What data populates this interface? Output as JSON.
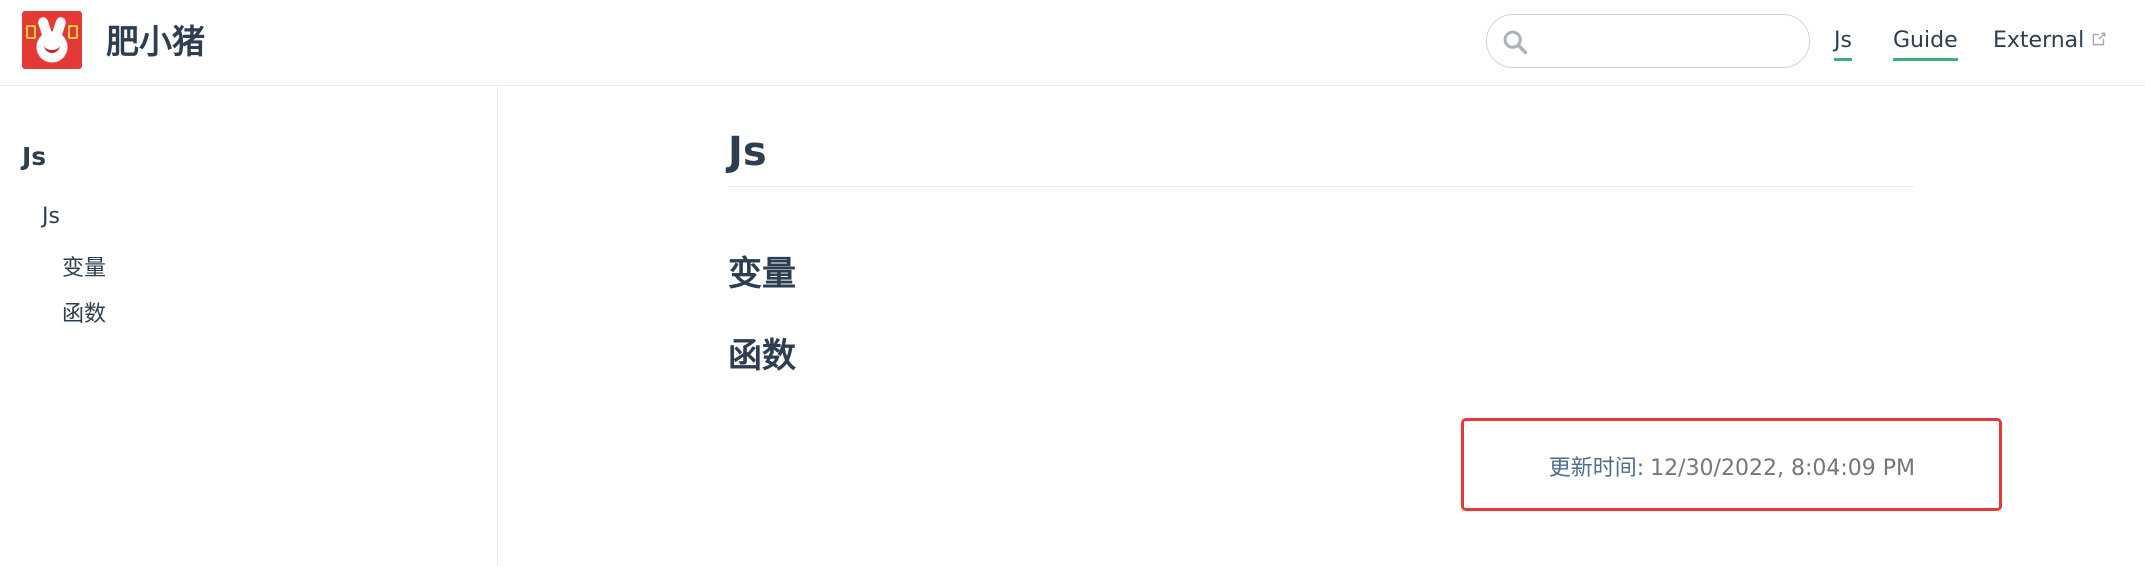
{
  "navbar": {
    "site_title": "肥小猪",
    "logo_icon": "pig-sticker-logo",
    "search": {
      "placeholder": "",
      "value": "",
      "icon": "search-icon"
    },
    "links": [
      {
        "label": "Js",
        "active": true
      },
      {
        "label": "Guide",
        "active": true
      },
      {
        "label": "External",
        "external_icon": "external-link-icon"
      }
    ]
  },
  "sidebar": {
    "heading": "Js",
    "items": [
      {
        "label": "Js",
        "level": 1
      },
      {
        "label": "变量",
        "level": 2
      },
      {
        "label": "函数",
        "level": 2
      }
    ]
  },
  "main": {
    "title": "Js",
    "headings": [
      "变量",
      "函数"
    ],
    "last_updated": {
      "prefix": "更新时间:",
      "value": "12/30/2022, 8:04:09 PM"
    }
  },
  "colors": {
    "text": "#2c3e50",
    "accent": "#3eaf7c",
    "border": "#eaecef",
    "highlight_box": "#e53935"
  }
}
